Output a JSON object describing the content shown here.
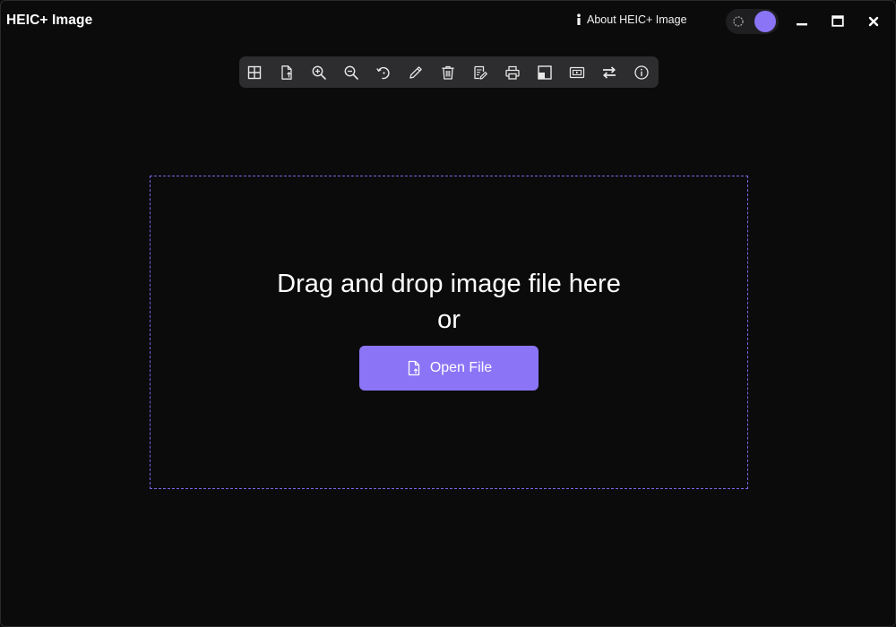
{
  "window": {
    "title": "HEIC+ Image",
    "about_label": "About HEIC+ Image"
  },
  "toolbar": {
    "tools": [
      {
        "icon": "grid-icon"
      },
      {
        "icon": "file-export-icon"
      },
      {
        "icon": "zoom-in-icon"
      },
      {
        "icon": "zoom-out-icon"
      },
      {
        "icon": "rotate-icon"
      },
      {
        "icon": "pencil-icon"
      },
      {
        "icon": "trash-icon"
      },
      {
        "icon": "edit-document-icon"
      },
      {
        "icon": "print-icon"
      },
      {
        "icon": "set-wallpaper-icon"
      },
      {
        "icon": "slideshow-icon"
      },
      {
        "icon": "swap-icon"
      },
      {
        "icon": "info-icon"
      }
    ]
  },
  "dropzone": {
    "line1": "Drag and drop image file here",
    "line2": "or",
    "open_button_label": "Open File"
  },
  "colors": {
    "accent": "#8b75f6",
    "background": "#0b0b0c",
    "toolbar_bg": "#2d2d2f",
    "dropzone_border": "#7a66e0"
  }
}
